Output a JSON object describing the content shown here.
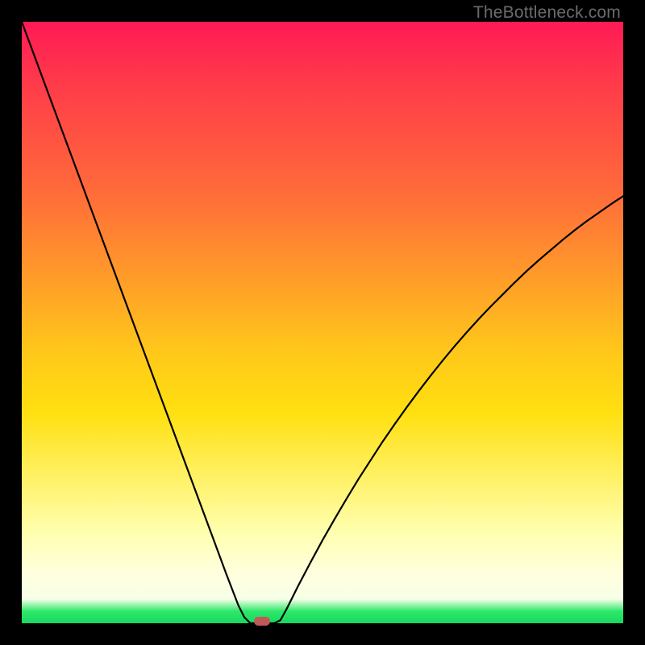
{
  "watermark": "TheBottleneck.com",
  "colors": {
    "frame": "#000000",
    "curve": "#000000",
    "marker": "#c05a5a",
    "gradient_stops": [
      "#ff1a55",
      "#ff3a4a",
      "#ff6a3a",
      "#ff9a2a",
      "#ffc81a",
      "#ffe010",
      "#fff060",
      "#ffffb0",
      "#ffffe0",
      "#f6ffe6",
      "#2fe86a",
      "#18d860"
    ]
  },
  "chart_data": {
    "type": "line",
    "title": "",
    "xlabel": "",
    "ylabel": "",
    "xlim": [
      0,
      100
    ],
    "ylim": [
      0,
      100
    ],
    "x": [
      0,
      2,
      4,
      6,
      8,
      10,
      12,
      14,
      16,
      18,
      20,
      22,
      24,
      26,
      28,
      30,
      32,
      34,
      36,
      37,
      38,
      39,
      40,
      41,
      42,
      43,
      44,
      46,
      48,
      50,
      52,
      54,
      56,
      58,
      60,
      62,
      64,
      66,
      68,
      70,
      72,
      74,
      76,
      78,
      80,
      82,
      84,
      86,
      88,
      90,
      92,
      94,
      96,
      98,
      100
    ],
    "values": [
      100,
      94.6,
      89.2,
      83.8,
      78.4,
      73.0,
      67.6,
      62.2,
      56.8,
      51.4,
      46.0,
      40.6,
      35.2,
      29.8,
      24.4,
      19.0,
      13.6,
      8.2,
      3.0,
      1.0,
      0.0,
      0.0,
      0.0,
      0.0,
      0.0,
      0.5,
      2.3,
      6.3,
      10.1,
      13.8,
      17.3,
      20.7,
      24.0,
      27.1,
      30.2,
      33.1,
      35.9,
      38.6,
      41.2,
      43.7,
      46.1,
      48.4,
      50.6,
      52.7,
      54.7,
      56.7,
      58.6,
      60.4,
      62.1,
      63.8,
      65.4,
      66.9,
      68.3,
      69.7,
      71.0
    ],
    "marker": {
      "x": 40,
      "y": 0,
      "color": "#c05a5a"
    },
    "note": "V-shaped bottleneck curve; minimum (0) occurs around x≈38–42. Values are percentages estimated from the plot."
  }
}
